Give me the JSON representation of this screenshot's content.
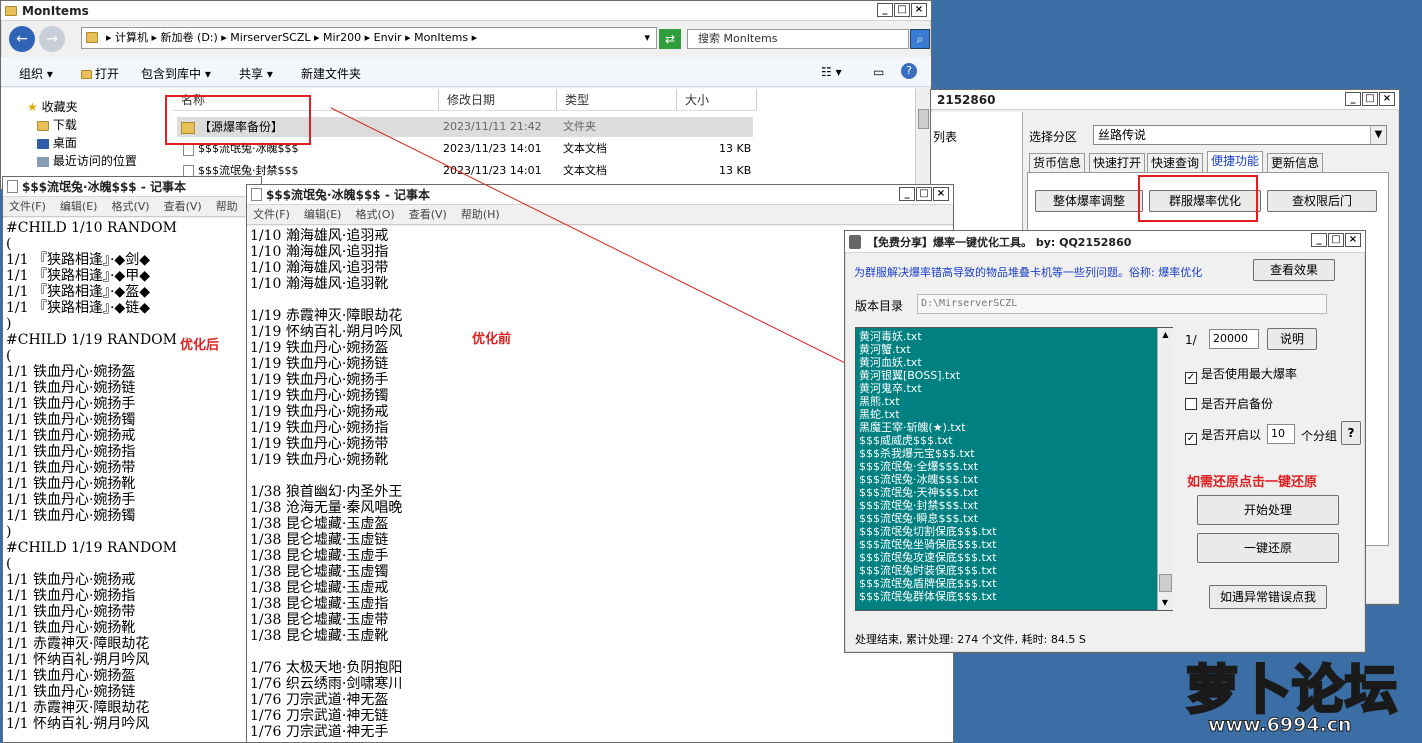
{
  "explorer": {
    "title": "MonItems",
    "address": "▸ 计算机 ▸ 新加卷 (D:) ▸ MirserverSCZL ▸ Mir200 ▸ Envir ▸ MonItems ▸",
    "search_placeholder": "搜索 MonItems",
    "commands": [
      "组织 ▾",
      "打开",
      "包含到库中 ▾",
      "共享 ▾",
      "新建文件夹"
    ],
    "nav": [
      "收藏夹",
      "下载",
      "桌面",
      "最近访问的位置"
    ],
    "columns": [
      "名称",
      "修改日期",
      "类型",
      "大小"
    ],
    "rows": [
      {
        "name": "【源爆率备份】",
        "date": "2023/11/11 21:42",
        "type": "文件夹",
        "size": ""
      },
      {
        "name": "$$$流氓兔·冰魄$$$",
        "date": "2023/11/23 14:01",
        "type": "文本文档",
        "size": "13 KB"
      },
      {
        "name": "$$$流氓兔·封禁$$$",
        "date": "2023/11/23 14:01",
        "type": "文本文档",
        "size": "13 KB"
      }
    ]
  },
  "notepad_front": {
    "title": "$$$流氓兔·冰魄$$$ - 记事本",
    "menu": [
      "文件(F)",
      "编辑(E)",
      "格式(O)",
      "查看(V)",
      "帮助(H)"
    ],
    "lines": [
      "1/10 瀚海雄风·追羽戒",
      "1/10 瀚海雄风·追羽指",
      "1/10 瀚海雄风·追羽带",
      "1/10 瀚海雄风·追羽靴",
      "",
      "1/19 赤霞神灭·障眼劫花",
      "1/19 怀纳百礼·朔月吟风",
      "1/19 铁血丹心·婉扬盔",
      "1/19 铁血丹心·婉扬链",
      "1/19 铁血丹心·婉扬手",
      "1/19 铁血丹心·婉扬镯",
      "1/19 铁血丹心·婉扬戒",
      "1/19 铁血丹心·婉扬指",
      "1/19 铁血丹心·婉扬带",
      "1/19 铁血丹心·婉扬靴",
      "",
      "1/38 狼首幽幻·内圣外王",
      "1/38 沧海无量·秦风唱晚",
      "1/38 昆仑墟藏·玉虚盔",
      "1/38 昆仑墟藏·玉虚链",
      "1/38 昆仑墟藏·玉虚手",
      "1/38 昆仑墟藏·玉虚镯",
      "1/38 昆仑墟藏·玉虚戒",
      "1/38 昆仑墟藏·玉虚指",
      "1/38 昆仑墟藏·玉虚带",
      "1/38 昆仑墟藏·玉虚靴",
      "",
      "1/76 太极天地·负阴抱阳",
      "1/76 织云绣雨·剑啸寒川",
      "1/76 刀宗武道·神无盔",
      "1/76 刀宗武道·神无链",
      "1/76 刀宗武道·神无手"
    ],
    "annotation": "优化前"
  },
  "notepad_back": {
    "title": "$$$流氓兔·冰魄$$$ - 记事本",
    "menu": [
      "文件(F)",
      "编辑(E)",
      "格式(V)",
      "查看(V)",
      "帮助"
    ],
    "lines": [
      "#CHILD 1/10 RANDOM",
      "(",
      "1/1 『狭路相逢』·◆剑◆",
      "1/1 『狭路相逢』·◆甲◆",
      "1/1 『狭路相逢』·◆盔◆",
      "1/1 『狭路相逢』·◆链◆",
      ")",
      "#CHILD 1/19 RANDOM",
      "(",
      "1/1 铁血丹心·婉扬盔",
      "1/1 铁血丹心·婉扬链",
      "1/1 铁血丹心·婉扬手",
      "1/1 铁血丹心·婉扬镯",
      "1/1 铁血丹心·婉扬戒",
      "1/1 铁血丹心·婉扬指",
      "1/1 铁血丹心·婉扬带",
      "1/1 铁血丹心·婉扬靴",
      "1/1 铁血丹心·婉扬手",
      "1/1 铁血丹心·婉扬镯",
      ")",
      "#CHILD 1/19 RANDOM",
      "(",
      "1/1 铁血丹心·婉扬戒",
      "1/1 铁血丹心·婉扬指",
      "1/1 铁血丹心·婉扬带",
      "1/1 铁血丹心·婉扬靴",
      "1/1 赤霞神灭·障眼劫花",
      "1/1 怀纳百礼·朔月吟风",
      "1/1 铁血丹心·婉扬盔",
      "1/1 铁血丹心·婉扬链",
      "1/1 赤霞神灭·障眼劫花",
      "1/1 怀纳百礼·朔月吟风"
    ],
    "annotation": "优化后"
  },
  "config_window": {
    "title_suffix": "2152860",
    "left_fragment_1": "列表",
    "left_fragment_2": "区",
    "zone_label": "选择分区",
    "zone_value": "丝路传说",
    "tabs": [
      "货币信息",
      "快速打开",
      "快速查询",
      "便捷功能",
      "更新信息"
    ],
    "buttons": [
      "整体爆率调整",
      "群服爆率优化",
      "查权限后门"
    ]
  },
  "tool": {
    "title": "【免费分享】爆率一键优化工具。    by: QQ2152860",
    "description": "为群服解决爆率错高导致的物品堆叠卡机等一些列问题。俗称: 爆率优化",
    "view_effect": "查看效果",
    "dir_label": "版本目录",
    "dir_value": "D:\\MirserverSCZL",
    "files": [
      "黄河毒妖.txt",
      "黄河蟹.txt",
      "黄河血妖.txt",
      "黄河银翼[BOSS].txt",
      "黄河鬼卒.txt",
      "黑熊.txt",
      "黑蛇.txt",
      "黑魔王宰·斩魄(★).txt",
      "$$$威威虎$$$.txt",
      "$$$杀我爆元宝$$$.txt",
      "$$$流氓兔·全爆$$$.txt",
      "$$$流氓兔·冰魄$$$.txt",
      "$$$流氓兔·天神$$$.txt",
      "$$$流氓兔·封禁$$$.txt",
      "$$$流氓兔·瞬息$$$.txt",
      "$$$流氓兔切割保底$$$.txt",
      "$$$流氓兔坐骑保底$$$.txt",
      "$$$流氓兔攻速保底$$$.txt",
      "$$$流氓兔时装保底$$$.txt",
      "$$$流氓兔盾牌保底$$$.txt",
      "$$$流氓兔群体保底$$$.txt"
    ],
    "ratio_prefix": "1/",
    "ratio_value": "20000",
    "explain": "说明",
    "chk_max": "是否使用最大爆率",
    "chk_backup": "是否开启备份",
    "chk_group_prefix": "是否开启以",
    "group_value": "10",
    "group_suffix": "个分组",
    "question": "?",
    "restore_hint": "如需还原点击一键还原",
    "start": "开始处理",
    "restore": "一键还原",
    "error_contact": "如遇异常错误点我",
    "status": "处理结束, 累计处理: 274 个文件, 耗时: 84.5 S"
  },
  "watermark": {
    "main": "萝卜论坛",
    "url": "www.6994.cn"
  },
  "colors": {
    "list_bg": "#008080",
    "accent_red": "#e02020",
    "desktop": "#3a6ea5",
    "link_blue": "#1a3fc8"
  }
}
